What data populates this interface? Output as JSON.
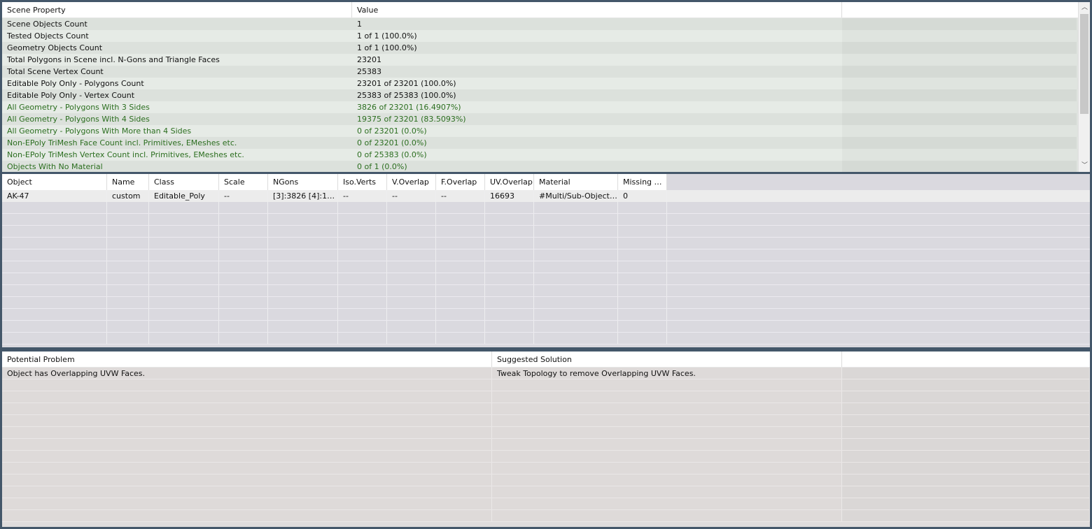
{
  "scene_panel": {
    "headers": [
      "Scene Property",
      "Value",
      ""
    ],
    "rows": [
      {
        "property": "Scene Objects Count",
        "value": "1",
        "highlight": false
      },
      {
        "property": "Tested Objects Count",
        "value": "1 of 1 (100.0%)",
        "highlight": false
      },
      {
        "property": "Geometry Objects Count",
        "value": "1 of 1 (100.0%)",
        "highlight": false
      },
      {
        "property": "Total Polygons in Scene incl. N-Gons and Triangle Faces",
        "value": "23201",
        "highlight": false
      },
      {
        "property": "Total Scene Vertex Count",
        "value": "25383",
        "highlight": false
      },
      {
        "property": "Editable Poly Only - Polygons Count",
        "value": "23201 of 23201 (100.0%)",
        "highlight": false
      },
      {
        "property": "Editable Poly Only - Vertex Count",
        "value": "25383 of 25383 (100.0%)",
        "highlight": false
      },
      {
        "property": "All Geometry - Polygons With 3 Sides",
        "value": "3826 of 23201 (16.4907%)",
        "highlight": true
      },
      {
        "property": "All Geometry - Polygons With 4 Sides",
        "value": "19375 of 23201 (83.5093%)",
        "highlight": true
      },
      {
        "property": "All Geometry - Polygons With More than 4 Sides",
        "value": "0 of 23201 (0.0%)",
        "highlight": true
      },
      {
        "property": "Non-EPoly TriMesh Face Count incl. Primitives, EMeshes etc.",
        "value": "0 of 23201 (0.0%)",
        "highlight": true
      },
      {
        "property": "Non-EPoly TriMesh Vertex Count incl. Primitives, EMeshes etc.",
        "value": "0 of 25383 (0.0%)",
        "highlight": true
      },
      {
        "property": "Objects With No Material",
        "value": "0 of 1 (0.0%)",
        "highlight": true
      }
    ],
    "scrollbar": {
      "up_icon": "chevron-up-icon",
      "down_icon": "chevron-down-icon",
      "up_glyph": "︿",
      "down_glyph": "﹀"
    },
    "highlight_color": "#2b6e1f"
  },
  "object_panel": {
    "headers": [
      "Object",
      "Name",
      "Class",
      "Scale",
      "NGons",
      "Iso.Verts",
      "V.Overlap",
      "F.Overlap",
      "UV.Overlap",
      "Material",
      "Missing M..."
    ],
    "rows": [
      [
        "AK-47",
        "custom",
        "Editable_Poly",
        "--",
        "[3]:3826 [4]:19...",
        "--",
        "--",
        "--",
        "16693",
        "#Multi/Sub-Object:...",
        "0"
      ]
    ],
    "empty_rows": 12
  },
  "problem_panel": {
    "headers": [
      "Potential Problem",
      "Suggested Solution",
      ""
    ],
    "rows": [
      {
        "problem": "Object has Overlapping UVW Faces.",
        "solution": "Tweak Topology to remove Overlapping UVW Faces."
      }
    ],
    "empty_rows": 12
  }
}
